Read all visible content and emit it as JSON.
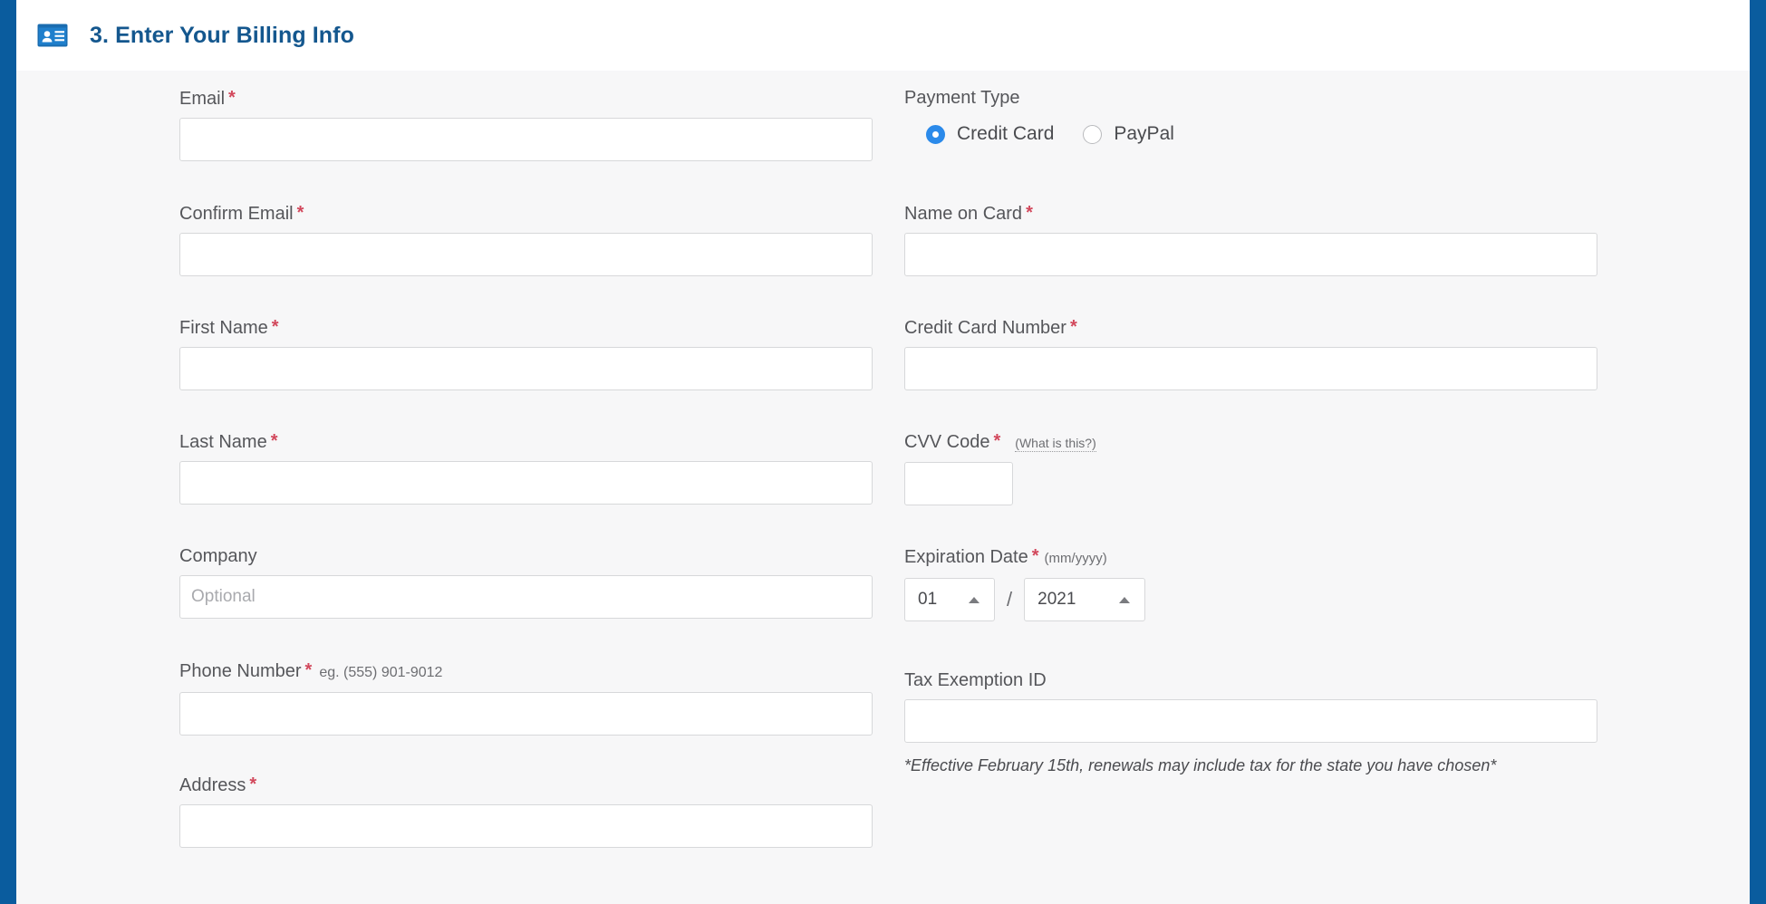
{
  "header": {
    "icon": "id-card-icon",
    "title": "3. Enter Your Billing Info",
    "title_color": "#14578e"
  },
  "theme": {
    "rail_color": "#0a5c9e",
    "header_bg": "#ffffff",
    "body_bg": "#f7f7f8",
    "required_marker_color": "#d2485c",
    "radio_selected_color": "#2b8aea",
    "input_border": "#d7d8da"
  },
  "required_marker": "*",
  "left_column": {
    "fields": [
      {
        "label": "Email",
        "required": true,
        "value": "",
        "placeholder": ""
      },
      {
        "label": "Confirm Email",
        "required": true,
        "value": "",
        "placeholder": ""
      },
      {
        "label": "First Name",
        "required": true,
        "value": "",
        "placeholder": ""
      },
      {
        "label": "Last Name",
        "required": true,
        "value": "",
        "placeholder": ""
      },
      {
        "label": "Company",
        "required": false,
        "value": "",
        "placeholder": "Optional"
      },
      {
        "label": "Phone Number",
        "required": true,
        "hint": "eg. (555) 901-9012",
        "value": "",
        "placeholder": ""
      },
      {
        "label": "Address",
        "required": true,
        "value": "",
        "placeholder": ""
      }
    ]
  },
  "right_column": {
    "payment_type": {
      "label": "Payment Type",
      "options": [
        {
          "label": "Credit Card",
          "selected": true
        },
        {
          "label": "PayPal",
          "selected": false
        }
      ]
    },
    "name_on_card": {
      "label": "Name on Card",
      "required": true,
      "value": "",
      "placeholder": ""
    },
    "credit_card_number": {
      "label": "Credit Card Number",
      "required": true,
      "value": "",
      "placeholder": ""
    },
    "cvv": {
      "label": "CVV Code",
      "required": true,
      "help_link": "(What is this?)",
      "value": "",
      "placeholder": ""
    },
    "expiration": {
      "label": "Expiration Date",
      "required": true,
      "format_hint": "(mm/yyyy)",
      "month": "01",
      "separator": "/",
      "year": "2021"
    },
    "tax_exemption": {
      "label": "Tax Exemption ID",
      "required": false,
      "value": "",
      "placeholder": ""
    },
    "tax_note": "*Effective February 15th, renewals may include tax for the state you have chosen*"
  }
}
